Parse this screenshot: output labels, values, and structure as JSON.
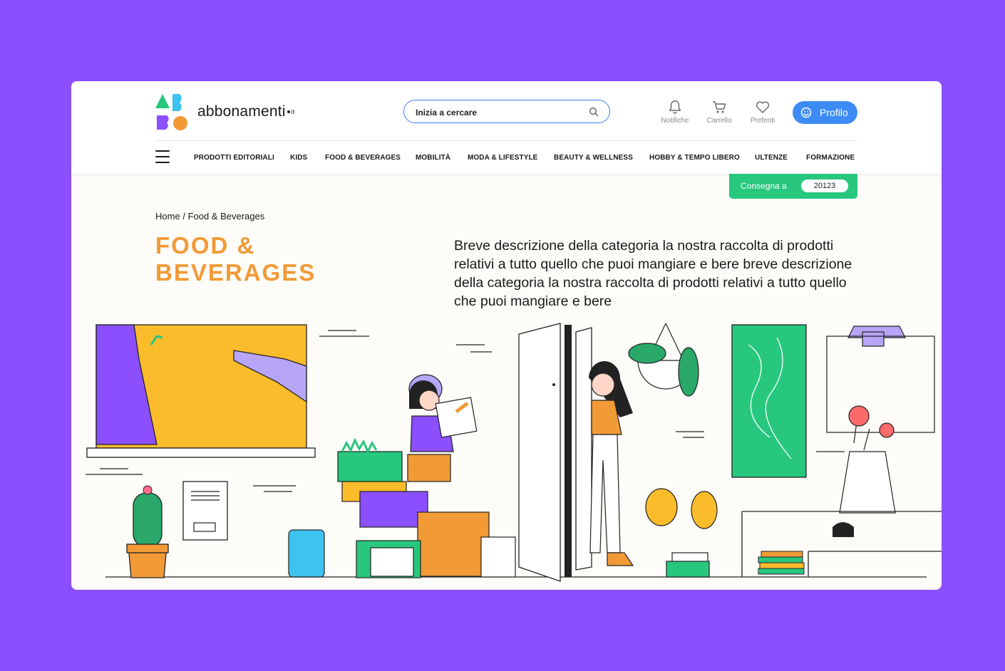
{
  "brand": {
    "name": "abbonamenti",
    "tld": "it"
  },
  "search": {
    "placeholder": "Inizia a cercare"
  },
  "toolbar": {
    "notifications_label": "Notifiche",
    "cart_label": "Carrello",
    "favorites_label": "Preferiti",
    "profile_label": "Profilo"
  },
  "nav": {
    "items": [
      "PRODOTTI EDITORIALI",
      "KIDS",
      "FOOD & BEVERAGES",
      "MOBILITÀ",
      "MODA & LIFESTYLE",
      "BEAUTY & WELLNESS",
      "HOBBY & TEMPO LIBERO",
      "ULTENZE",
      "FORMAZIONE"
    ]
  },
  "delivery": {
    "label": "Consegna a",
    "zip": "20123"
  },
  "breadcrumb": {
    "home": "Home",
    "separator": "/",
    "current": "Food & Beverages"
  },
  "category": {
    "title_line1": "FOOD &",
    "title_line2": "BEVERAGES",
    "description": "Breve descrizione della categoria la nostra raccolta di prodotti relativi a tutto quello che puoi mangiare e bere breve descrizione della categoria la nostra raccolta di prodotti relativi a tutto quello che puoi mangiare e bere"
  },
  "colors": {
    "background": "#8b4ffe",
    "accent_orange": "#f29a36",
    "accent_blue": "#3d8cf6",
    "accent_green": "#27c77e"
  },
  "illustration": {
    "icon": "delivery-scene-illustration"
  }
}
